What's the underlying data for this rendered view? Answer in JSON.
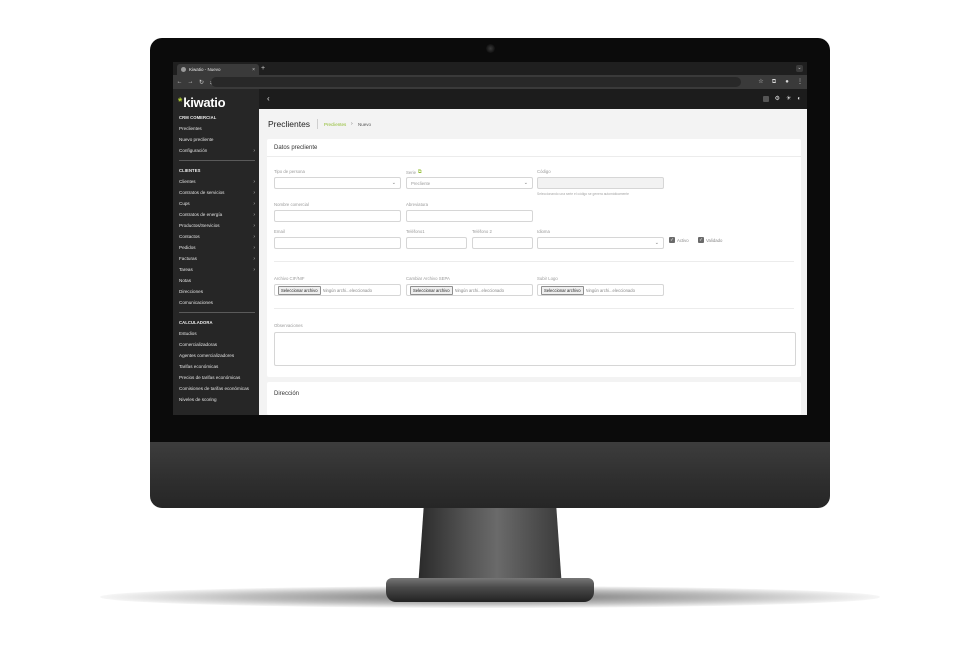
{
  "browser": {
    "tab_title": "Kiwatio - Nuevo",
    "tab_close": "×",
    "new_tab": "+",
    "tab_menu": "⌄",
    "back": "←",
    "forward": "→",
    "reload": "↻",
    "site_info": "⇄",
    "bookmark": "☆",
    "extensions": "⧉",
    "profile": "●",
    "menu": "⋮"
  },
  "sidebar": {
    "logo_mark": "*",
    "logo_text": "kiwatio",
    "sections": [
      {
        "title": "CRM COMERCIAL",
        "items": [
          {
            "label": "Preclientes",
            "chevron": ""
          },
          {
            "label": "Nuevo precliente",
            "chevron": ""
          },
          {
            "label": "Configuración",
            "chevron": "›"
          }
        ]
      },
      {
        "title": "CLIENTES",
        "items": [
          {
            "label": "Clientes",
            "chevron": "›"
          },
          {
            "label": "Contratos de servicios",
            "chevron": "›"
          },
          {
            "label": "Cups",
            "chevron": "›"
          },
          {
            "label": "Contratos de energía",
            "chevron": "›"
          },
          {
            "label": "Productos/Servicios",
            "chevron": "›"
          },
          {
            "label": "Contactos",
            "chevron": "›"
          },
          {
            "label": "Pedidos",
            "chevron": "›"
          },
          {
            "label": "Facturas",
            "chevron": "›"
          },
          {
            "label": "Tareas",
            "chevron": "›"
          },
          {
            "label": "Notas",
            "chevron": ""
          },
          {
            "label": "Direcciones",
            "chevron": ""
          },
          {
            "label": "Comunicaciones",
            "chevron": ""
          }
        ]
      },
      {
        "title": "CALCULADORA",
        "items": [
          {
            "label": "Estudios",
            "chevron": ""
          },
          {
            "label": "Comercializadoras",
            "chevron": ""
          },
          {
            "label": "Agentes comercializadores",
            "chevron": ""
          },
          {
            "label": "Tarifas económicas",
            "chevron": ""
          },
          {
            "label": "Precios de tarifas económicas",
            "chevron": ""
          },
          {
            "label": "Comisiones de tarifas económicas",
            "chevron": ""
          },
          {
            "label": "Niveles de scoring",
            "chevron": ""
          }
        ]
      }
    ]
  },
  "appbar": {
    "back": "‹",
    "settings_icon": "⚙",
    "theme_icon": "☀",
    "palette_icon": "◐"
  },
  "page": {
    "title": "Preclientes",
    "breadcrumb_link": "Preclientes",
    "breadcrumb_sep": "›",
    "breadcrumb_current": "Nuevo"
  },
  "form": {
    "card_title": "Datos precliente",
    "tipo_persona_label": "Tipo de persona",
    "tipo_persona_value": "",
    "serie_label": "Serie",
    "serie_ext_icon": "⧉",
    "serie_value": "Precliente",
    "codigo_label": "Código",
    "codigo_hint": "Seleccionando una serie el código se genera automáticamente",
    "nombre_label": "Nombre comercial",
    "abreviatura_label": "Abreviatura",
    "email_label": "Email",
    "telefono1_label": "Teléfono1",
    "telefono2_label": "Teléfono 2",
    "idioma_label": "Idioma",
    "activo_label": "Activo",
    "validado_label": "Validado",
    "check_mark": "✓",
    "dropdown_arrow": "⌄",
    "archivo_cif_label": "Archivo CIF/NIF",
    "sepa_label": "Cambiar Archivo SEPA",
    "logo_label": "Subir Logo",
    "file_button": "Seleccionar archivo",
    "file_none": "Ningún archi...eleccionado",
    "observaciones_label": "Observaciones",
    "direccion_title": "Dirección"
  }
}
